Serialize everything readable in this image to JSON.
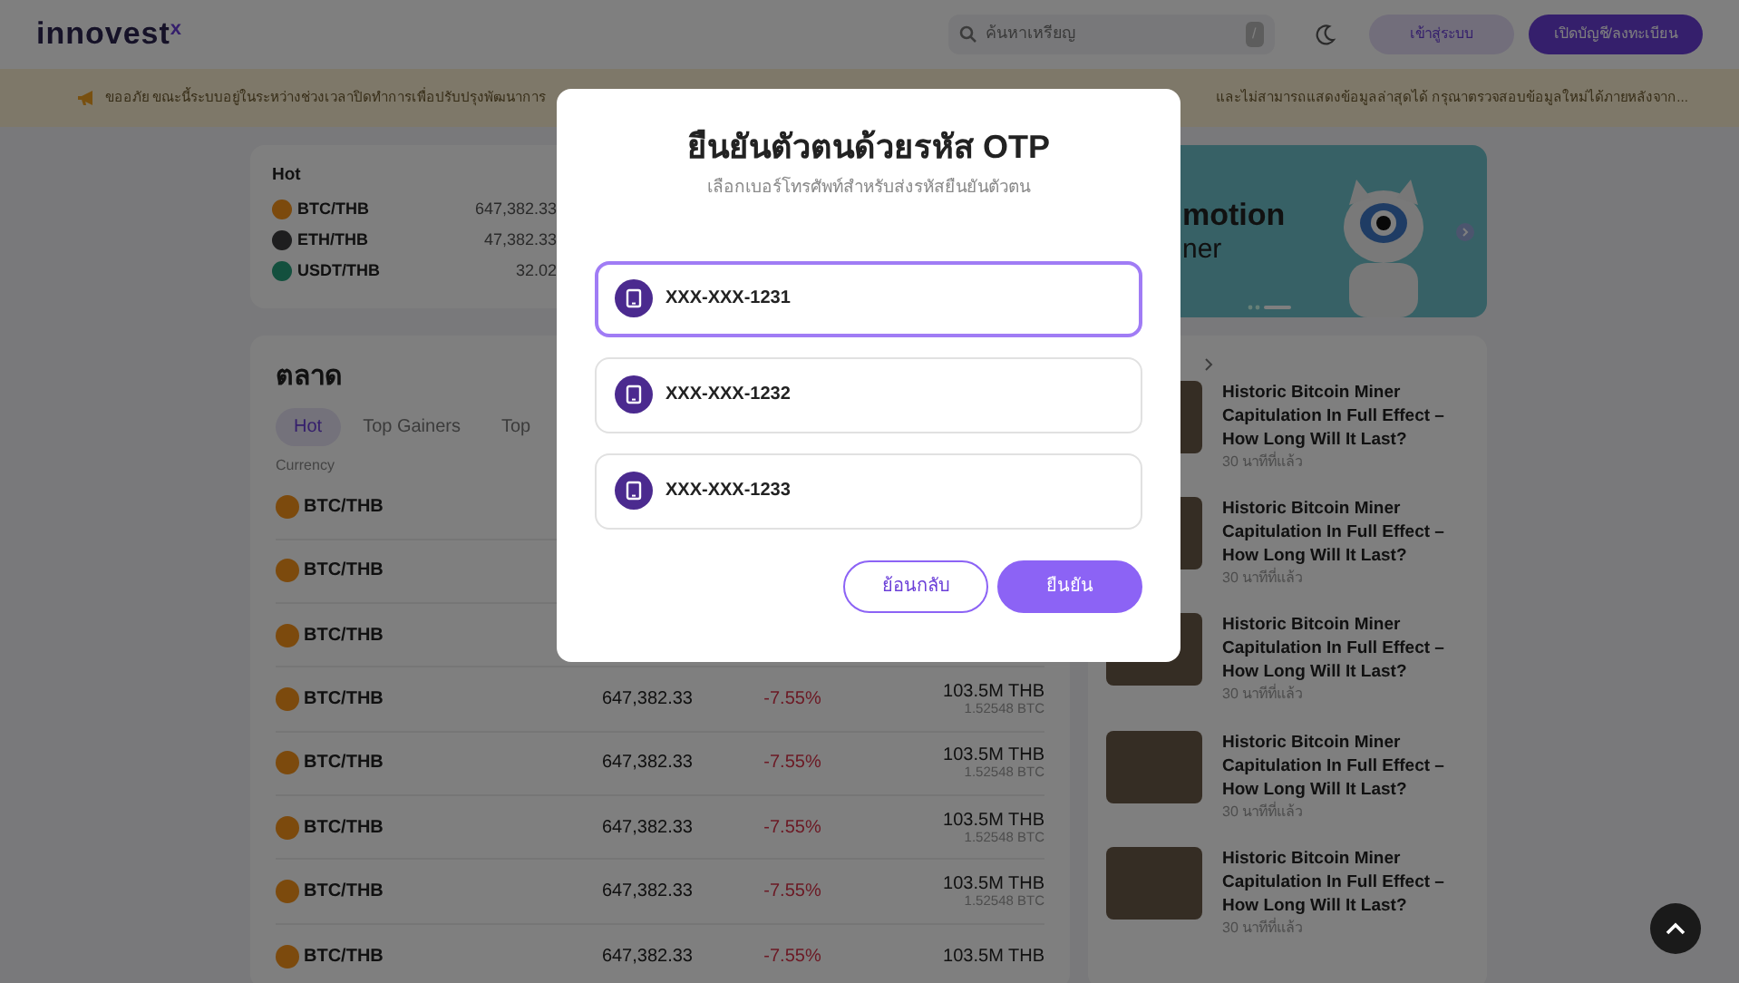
{
  "navbar": {
    "logo": "innovest$^{x}$",
    "search": {
      "placeholder": "ค้นหาเหรียญ",
      "shortcut": "/"
    },
    "buttons": [
      {
        "label": "เข้าสู่ระบบ",
        "kind": "outline"
      },
      {
        "label": "เปิดบัญชี/ลงทะเบียน",
        "kind": "primary"
      }
    ]
  },
  "notice": {
    "text_left": "ขออภัย ขณะนี้ระบบอยู่ในระหว่างช่วงเวลาปิดทำการเพื่อปรับปรุงพัฒนาการ",
    "text_right": "และไม่สามารถแสดงข้อมูลล่าสุดได้ กรุณาตรวจสอบข้อมูลใหม่ได้ภายหลังจาก..."
  },
  "hot": {
    "title": "Hot",
    "items": [
      {
        "pair": "BTC/THB",
        "price": "647,382.33",
        "color": "#7c4a0d"
      },
      {
        "pair": "ETH/THB",
        "price": "47,382.33",
        "color": "#1e1e1f"
      },
      {
        "pair": "USDT/THB",
        "price": "32.02",
        "color": "#13503e"
      }
    ]
  },
  "promo": {
    "title": "motion",
    "subtitle": "ner"
  },
  "market": {
    "title": "ตลาด",
    "tabs": [
      {
        "label": "Hot",
        "selected": true
      },
      {
        "label": "Top Gainers",
        "selected": false
      },
      {
        "label": "Top",
        "selected": false
      }
    ],
    "columns": [
      "Currency"
    ],
    "rows": [
      {
        "pair": "BTC/THB"
      },
      {
        "pair": "BTC/THB"
      },
      {
        "pair": "BTC/THB"
      },
      {
        "pair": "BTC/THB",
        "price": "647,382.33",
        "change": "-7.55%",
        "volume": "103.5M THB",
        "volume_sub": "1.52548 BTC"
      },
      {
        "pair": "BTC/THB",
        "price": "647,382.33",
        "change": "-7.55%",
        "volume": "103.5M THB",
        "volume_sub": "1.52548 BTC"
      },
      {
        "pair": "BTC/THB",
        "price": "647,382.33",
        "change": "-7.55%",
        "volume": "103.5M THB",
        "volume_sub": "1.52548 BTC"
      },
      {
        "pair": "BTC/THB",
        "price": "647,382.33",
        "change": "-7.55%",
        "volume": "103.5M THB",
        "volume_sub": "1.52548 BTC"
      },
      {
        "pair": "BTC/THB",
        "price": "647,382.33",
        "change": "-7.55%",
        "volume": "103.5M THB"
      }
    ]
  },
  "news": {
    "items": [
      {
        "title": "Historic Bitcoin Miner Capitulation In Full Effect – How Long Will It Last?",
        "time": "30 นาทีที่แล้ว"
      },
      {
        "title": "Historic Bitcoin Miner Capitulation In Full Effect – How Long Will It Last?",
        "time": "30 นาทีที่แล้ว"
      },
      {
        "title": "Historic Bitcoin Miner Capitulation In Full Effect – How Long Will It Last?",
        "time": "30 นาทีที่แล้ว"
      },
      {
        "title": "Historic Bitcoin Miner Capitulation In Full Effect – How Long Will It Last?",
        "time": "30 นาทีที่แล้ว"
      },
      {
        "title": "Historic Bitcoin Miner Capitulation In Full Effect – How Long Will It Last?",
        "time": "30 นาทีที่แล้ว"
      }
    ]
  },
  "modal": {
    "title": "ยืนยันตัวตนด้วยรหัส OTP",
    "subtitle": "เลือกเบอร์โทรศัพท์สำหรับส่งรหัสยืนยันตัวตน",
    "options": [
      {
        "label": "XXX-XXX-1231",
        "selected": true
      },
      {
        "label": "XXX-XXX-1232",
        "selected": false
      },
      {
        "label": "XXX-XXX-1233",
        "selected": false
      }
    ],
    "buttons": [
      {
        "label": "ย้อนกลับ",
        "kind": "outline"
      },
      {
        "label": "ยืนยัน",
        "kind": "primary"
      }
    ]
  }
}
